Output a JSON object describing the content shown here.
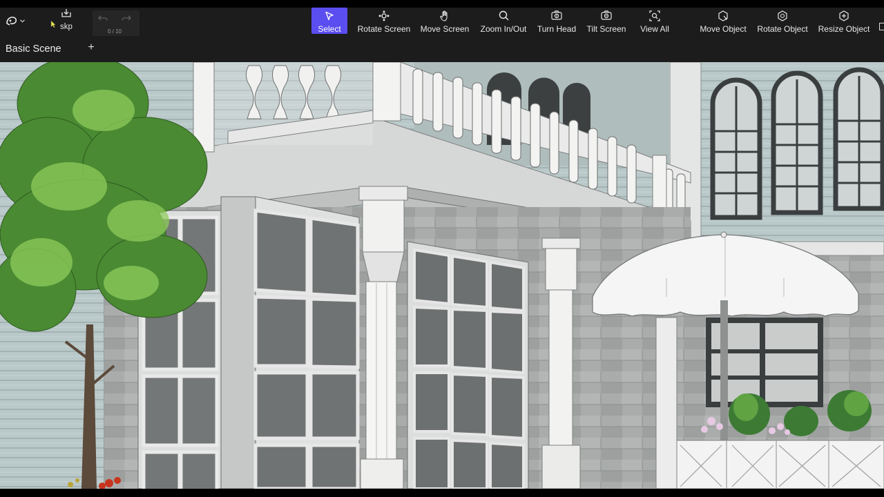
{
  "toolbar": {
    "file_label": "skp",
    "history_counter": "0 / 10",
    "tools": [
      {
        "label": "Select",
        "icon": "cursor-arrow-icon",
        "active": true
      },
      {
        "label": "Rotate Screen",
        "icon": "orbit-icon"
      },
      {
        "label": "Move Screen",
        "icon": "hand-icon"
      },
      {
        "label": "Zoom In/Out",
        "icon": "magnifier-icon"
      },
      {
        "label": "Turn Head",
        "icon": "head-camera-icon"
      },
      {
        "label": "Tilt Screen",
        "icon": "tilt-camera-icon"
      },
      {
        "label": "View All",
        "icon": "zoom-extents-icon"
      },
      {
        "label": "Move Object",
        "icon": "move-object-icon"
      },
      {
        "label": "Rotate Object",
        "icon": "rotate-object-icon"
      },
      {
        "label": "Resize Object",
        "icon": "resize-object-icon"
      }
    ]
  },
  "scenes": {
    "active": "Basic Scene",
    "add_label": "+"
  },
  "viewport": {
    "content": "3d-model-house-facade-with-balcony-tree-umbrella"
  },
  "colors": {
    "toolbar_bg": "#1c1c1c",
    "active_tool": "#5b4ef0",
    "text": "#e8e8e8",
    "muted_text": "#9a9a9a"
  }
}
